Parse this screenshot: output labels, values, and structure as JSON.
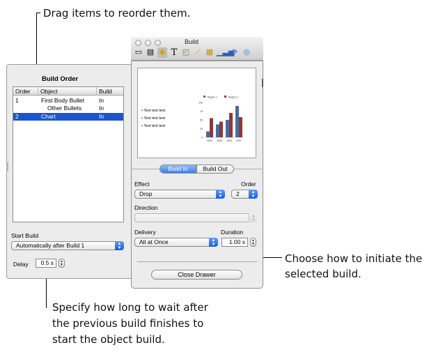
{
  "callouts": {
    "drag": "Drag items to reorder them.",
    "choose_1": "Choose how to initiate the",
    "choose_2": "selected build.",
    "specify_1": "Specify how long to wait after",
    "specify_2": "the previous build finishes to",
    "specify_3": "start the object build."
  },
  "drawer": {
    "title": "Build Order",
    "columns": [
      "Order",
      "Object",
      "Build"
    ],
    "rows": [
      {
        "order": "1",
        "object": "First Body Bullet",
        "build": "In",
        "selected": false
      },
      {
        "order": "",
        "object": "Other Bullets",
        "build": "In",
        "selected": false
      },
      {
        "order": "2",
        "object": "Chart",
        "build": "In",
        "selected": true
      }
    ],
    "start_build_label": "Start Build",
    "start_build_value": "Automatically after Build 1",
    "delay_label": "Delay",
    "delay_value": "0.5 s"
  },
  "inspector": {
    "title": "Build",
    "toolbar": [
      "document-icon",
      "slide-icon",
      "build-icon",
      "text-icon",
      "graphic-icon",
      "metrics-icon",
      "table-icon",
      "chart-icon",
      "hyperlink-icon",
      "quicktime-icon"
    ],
    "preview": {
      "bullets": [
        "Text text text",
        "Text text text",
        "Text text text"
      ]
    },
    "tabs": [
      "Build In",
      "Build Out"
    ],
    "active_tab": "Build In",
    "effect_label": "Effect",
    "effect_value": "Drop",
    "order_label": "Order",
    "order_value": "2",
    "direction_label": "Direction",
    "direction_value": "",
    "delivery_label": "Delivery",
    "delivery_value": "All at Once",
    "duration_label": "Duration",
    "duration_value": "1.00 s",
    "close_button": "Close Drawer"
  },
  "chart_data": {
    "type": "bar",
    "categories": [
      "2004",
      "2005",
      "2006",
      "2007"
    ],
    "series": [
      {
        "name": "Region 1",
        "values": [
          17,
          37,
          50,
          90
        ],
        "color": "#4a6b9a"
      },
      {
        "name": "Region 2",
        "values": [
          55,
          45,
          70,
          58
        ],
        "color": "#8b3a3a"
      }
    ],
    "yticks": [
      "0",
      "25",
      "50",
      "75",
      "100"
    ],
    "ylim": [
      0,
      100
    ],
    "legend": "top"
  }
}
